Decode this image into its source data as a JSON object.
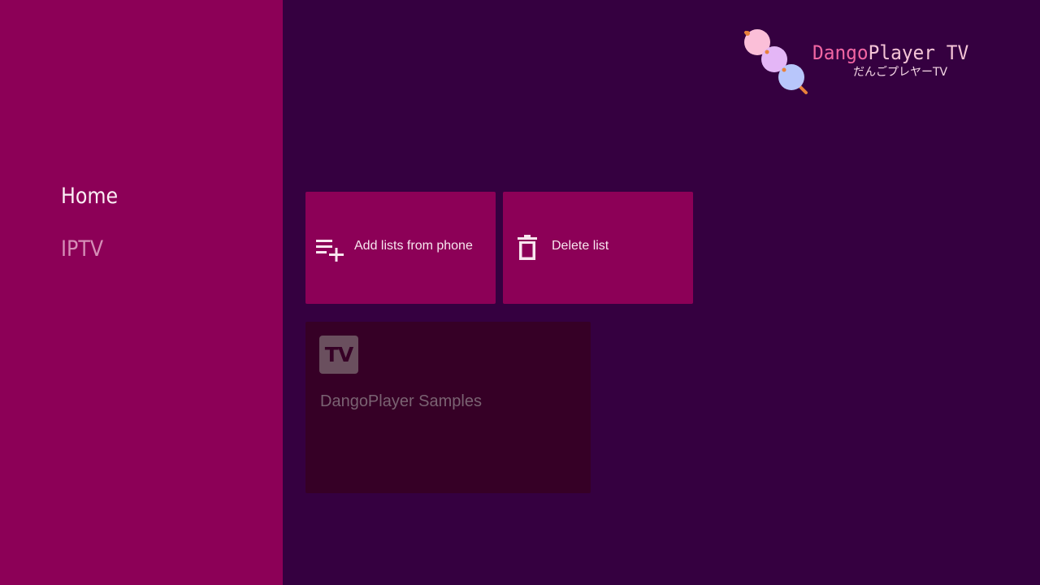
{
  "sidebar": {
    "items": [
      {
        "label": "Home",
        "state": "selected"
      },
      {
        "label": "IPTV",
        "state": "unselected"
      }
    ]
  },
  "logo": {
    "title_accent": "Dango",
    "title_rest": "Player TV",
    "subtitle": "だんごプレヤーTV",
    "icon": "dango-skewer-icon"
  },
  "actions": [
    {
      "label": "Add lists from phone",
      "icon": "playlist-add-icon"
    },
    {
      "label": "Delete list",
      "icon": "trash-icon"
    }
  ],
  "playlists": [
    {
      "badge": "TV",
      "title": "DangoPlayer Samples",
      "icon": "tv-badge-icon"
    }
  ],
  "colors": {
    "background": "#350040",
    "sidebar": "#8c0057",
    "tile": "#8c0057",
    "card": "#360026",
    "accent_pink": "#f266a3"
  }
}
